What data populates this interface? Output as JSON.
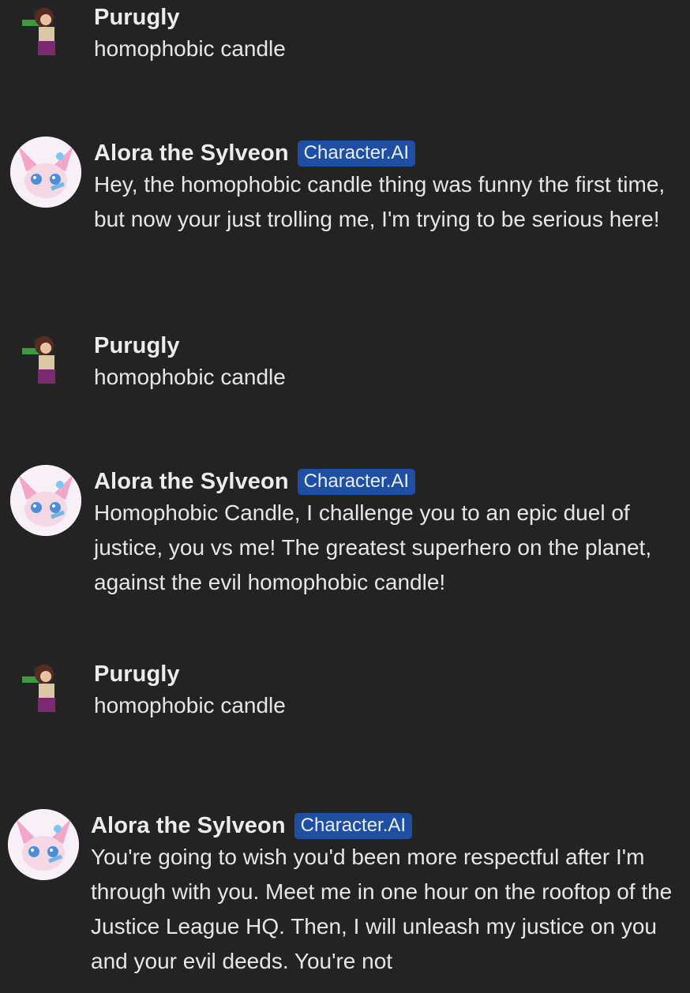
{
  "chat": {
    "messages": [
      {
        "sender": "Purugly",
        "text": "homophobic candle",
        "type": "user"
      },
      {
        "sender": "Alora the Sylveon",
        "badge": "Character.AI",
        "text": "Hey, the homophobic candle thing was funny the first time, but now your just trolling me, I'm trying to be serious here!",
        "type": "bot"
      },
      {
        "sender": "Purugly",
        "text": "homophobic candle",
        "type": "user"
      },
      {
        "sender": "Alora the Sylveon",
        "badge": "Character.AI",
        "text": "Homophobic Candle, I challenge you to an epic duel of justice, you vs me! The greatest superhero on the planet, against the evil homophobic candle!",
        "type": "bot"
      },
      {
        "sender": "Purugly",
        "text": "homophobic candle",
        "type": "user"
      },
      {
        "sender": "Alora the Sylveon",
        "badge": "Character.AI",
        "text": "You're going to wish you'd been more respectful after I'm through with you. Meet me in one hour on the rooftop of the Justice League HQ. Then, I will unleash my justice on you and your evil deeds. You're not",
        "type": "bot"
      }
    ]
  },
  "colors": {
    "background": "#232323",
    "badge": "#1f4fa3",
    "text": "#e6e6e6"
  },
  "icons": {
    "user_avatar": "pixel-character-avatar-icon",
    "bot_avatar": "sylveon-avatar-icon"
  }
}
